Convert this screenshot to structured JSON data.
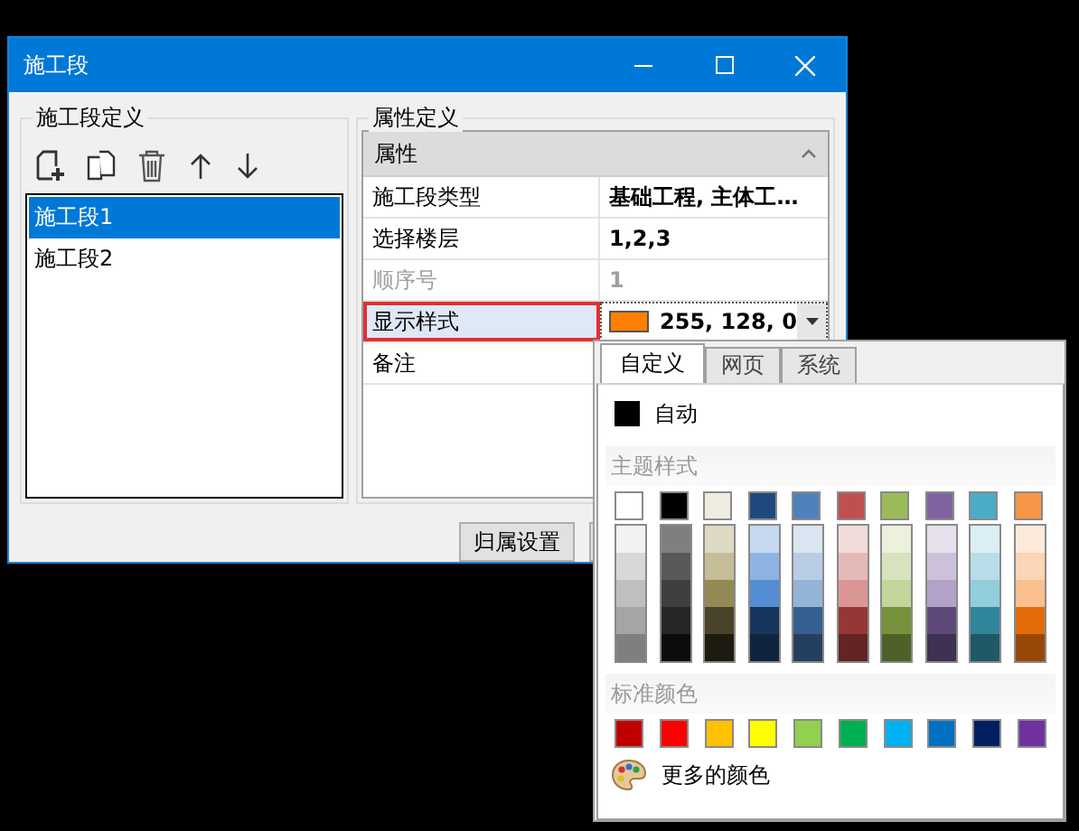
{
  "window": {
    "title": "施工段"
  },
  "segment_group": {
    "title": "施工段定义",
    "items": [
      {
        "label": "施工段1",
        "selected": true
      },
      {
        "label": "施工段2",
        "selected": false
      }
    ]
  },
  "property_group": {
    "title": "属性定义",
    "header": "属性",
    "rows": [
      {
        "kind": "text",
        "name": "施工段类型",
        "value": "基础工程, 主体工…",
        "disabled": false,
        "selected": false,
        "annotated": false
      },
      {
        "kind": "text",
        "name": "选择楼层",
        "value": "1,2,3",
        "disabled": false,
        "selected": false,
        "annotated": false
      },
      {
        "kind": "text",
        "name": "顺序号",
        "value": "1",
        "disabled": true,
        "selected": false,
        "annotated": false
      },
      {
        "kind": "color",
        "name": "显示样式",
        "value": "255, 128, 0",
        "color": "#ff8000",
        "disabled": false,
        "selected": true,
        "annotated": true
      },
      {
        "kind": "text",
        "name": "备注",
        "disabled": false,
        "selected": false,
        "annotated": false
      }
    ]
  },
  "buttons": [
    "归属设置"
  ],
  "color_popup": {
    "tabs": [
      {
        "label": "自定义",
        "selected": true
      },
      {
        "label": "网页",
        "selected": false
      },
      {
        "label": "系统",
        "selected": false
      }
    ],
    "auto": {
      "label": "自动",
      "color": "#000000"
    },
    "theme": {
      "title": "主题样式",
      "columns": [
        {
          "color": "#ffffff",
          "shades": [
            {
              "color": "#f2f2f2"
            },
            {
              "color": "#d8d8d8"
            },
            {
              "color": "#bfbfbf"
            },
            {
              "color": "#a5a5a5"
            },
            {
              "color": "#7f7f7f"
            }
          ]
        },
        {
          "color": "#000000",
          "shades": [
            {
              "color": "#7f7f7f"
            },
            {
              "color": "#595959"
            },
            {
              "color": "#3f3f3f"
            },
            {
              "color": "#262626"
            },
            {
              "color": "#0c0c0c"
            }
          ]
        },
        {
          "color": "#eeece1",
          "shades": [
            {
              "color": "#ddd9c3"
            },
            {
              "color": "#c4bd97"
            },
            {
              "color": "#938953"
            },
            {
              "color": "#494429"
            },
            {
              "color": "#1d1b10"
            }
          ]
        },
        {
          "color": "#1f497d",
          "shades": [
            {
              "color": "#c6d9f0"
            },
            {
              "color": "#8db3e2"
            },
            {
              "color": "#548dd4"
            },
            {
              "color": "#17365d"
            },
            {
              "color": "#0f243e"
            }
          ]
        },
        {
          "color": "#4f81bd",
          "shades": [
            {
              "color": "#dbe5f1"
            },
            {
              "color": "#b8cce4"
            },
            {
              "color": "#95b3d7"
            },
            {
              "color": "#366092"
            },
            {
              "color": "#244061"
            }
          ]
        },
        {
          "color": "#c0504d",
          "shades": [
            {
              "color": "#f2dcdb"
            },
            {
              "color": "#e5b9b7"
            },
            {
              "color": "#d99694"
            },
            {
              "color": "#953734"
            },
            {
              "color": "#632423"
            }
          ]
        },
        {
          "color": "#9bbb59",
          "shades": [
            {
              "color": "#ebf1dd"
            },
            {
              "color": "#d7e3bc"
            },
            {
              "color": "#c3d69b"
            },
            {
              "color": "#76923c"
            },
            {
              "color": "#4f6128"
            }
          ]
        },
        {
          "color": "#8064a2",
          "shades": [
            {
              "color": "#e5e0ec"
            },
            {
              "color": "#ccc1d9"
            },
            {
              "color": "#b2a2c7"
            },
            {
              "color": "#5f497a"
            },
            {
              "color": "#3f3151"
            }
          ]
        },
        {
          "color": "#4bacc6",
          "shades": [
            {
              "color": "#dbeef3"
            },
            {
              "color": "#b7dde8"
            },
            {
              "color": "#92cddc"
            },
            {
              "color": "#31859b"
            },
            {
              "color": "#205867"
            }
          ]
        },
        {
          "color": "#f79646",
          "shades": [
            {
              "color": "#fdeada"
            },
            {
              "color": "#fbd5b5"
            },
            {
              "color": "#fac08f"
            },
            {
              "color": "#e36c09"
            },
            {
              "color": "#974806"
            }
          ]
        }
      ]
    },
    "standard": {
      "title": "标准颜色",
      "colors": [
        {
          "color": "#c00000"
        },
        {
          "color": "#ff0000"
        },
        {
          "color": "#ffc000"
        },
        {
          "color": "#ffff00"
        },
        {
          "color": "#92d050"
        },
        {
          "color": "#00b050"
        },
        {
          "color": "#00b0f0"
        },
        {
          "color": "#0070c0"
        },
        {
          "color": "#002060"
        },
        {
          "color": "#7030a0"
        }
      ]
    },
    "more": "更多的颜色"
  }
}
